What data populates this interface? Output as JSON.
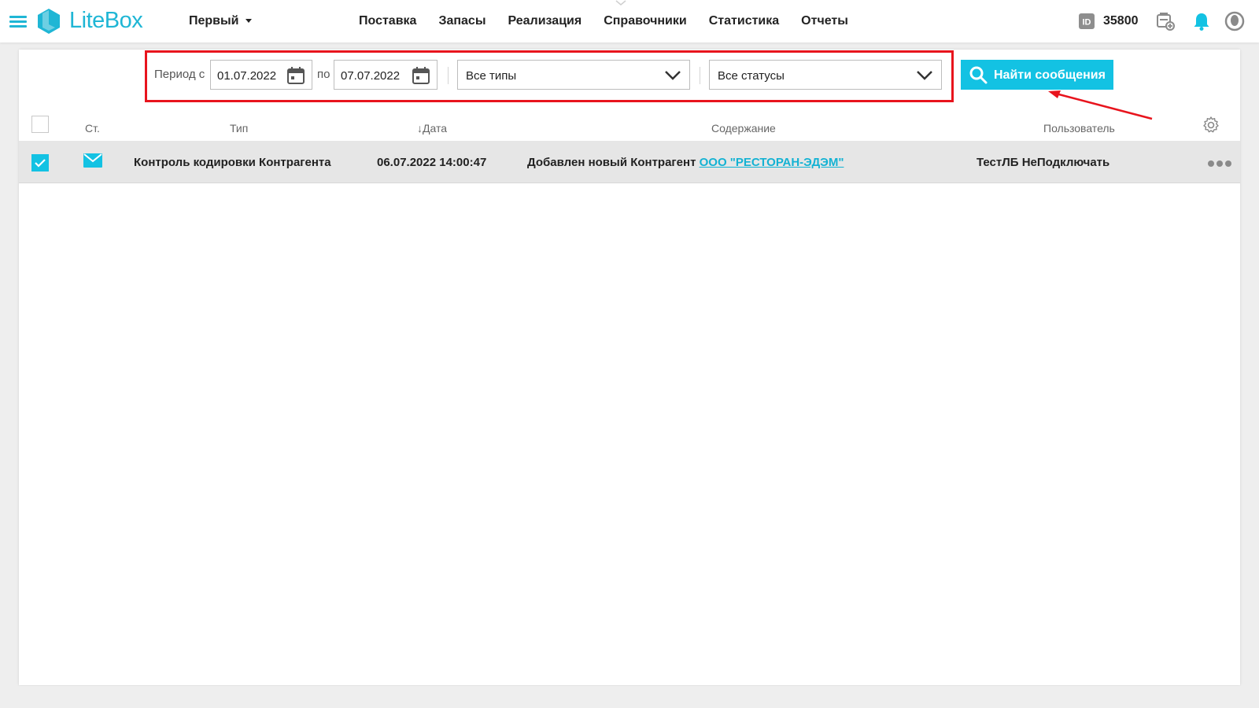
{
  "header": {
    "logo_text": "LiteBox",
    "store_name": "Первый",
    "nav": [
      "Поставка",
      "Запасы",
      "Реализация",
      "Справочники",
      "Статистика",
      "Отчеты"
    ],
    "id_badge_label": "ID",
    "id_number": "35800"
  },
  "filters": {
    "period_from_label": "Период с",
    "date_from": "01.07.2022",
    "period_to_label": "по",
    "date_to": "07.07.2022",
    "type_select": "Все типы",
    "status_select": "Все статусы",
    "find_button": "Найти сообщения"
  },
  "table": {
    "columns": {
      "status": "Ст.",
      "type": "Тип",
      "date": "Дата",
      "content": "Содержание",
      "user": "Пользователь"
    },
    "rows": [
      {
        "type": "Контроль кодировки Контрагента",
        "date": "06.07.2022 14:00:47",
        "content_text": "Добавлен новый Контрагент",
        "content_link": "ООО \"РЕСТОРАН-ЭДЭМ\"",
        "user": "ТестЛБ НеПодключать",
        "checked": true
      }
    ]
  },
  "icons": {
    "menu": "hamburger-icon",
    "store_caret": "caret-down-icon",
    "id": "id-card-icon",
    "cash_register": "register-add-icon",
    "notifications": "bell-icon",
    "profile": "user-icon",
    "calendar": "calendar-icon",
    "dropdown": "chevron-down-icon",
    "search": "search-icon",
    "settings": "gear-icon",
    "message": "envelope-icon",
    "more": "more-dots-icon"
  },
  "colors": {
    "accent": "#13c2e3",
    "logo": "#1fb6d5",
    "annotation": "#e8141d",
    "row_selected": "#e6e6e6"
  }
}
